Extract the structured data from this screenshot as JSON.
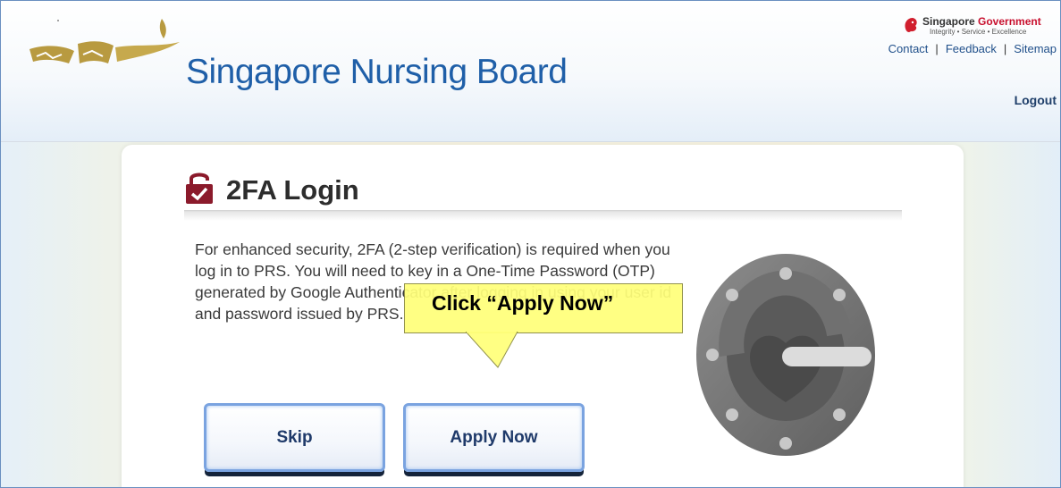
{
  "header": {
    "site_title": "Singapore Nursing Board",
    "gov": {
      "name_part1": "Singapore ",
      "name_part2": "Government",
      "tagline": "Integrity • Service • Excellence"
    },
    "links": {
      "contact": "Contact",
      "feedback": "Feedback",
      "sitemap": "Sitemap",
      "separator": "|"
    },
    "logout": "Logout"
  },
  "card": {
    "title": "2FA Login",
    "intro": "For enhanced security, 2FA (2-step verification) is required when you log in to PRS. You will need to key in a One-Time Password (OTP) generated by Google Authenticator after logging in using your user id and password issued by PRS.",
    "buttons": {
      "skip": "Skip",
      "apply": "Apply Now"
    }
  },
  "callout": {
    "text": "Click “Apply Now”"
  },
  "icons": {
    "logo": "snb-lamp-logo",
    "gov_logo": "lion-head-icon",
    "lock": "lock-check-icon",
    "authenticator": "google-authenticator-icon"
  },
  "colors": {
    "title_blue": "#1f5fa8",
    "lock_red": "#8b1a2b",
    "callout_yellow": "#ffff7a",
    "button_border": "#7aa3e0"
  }
}
